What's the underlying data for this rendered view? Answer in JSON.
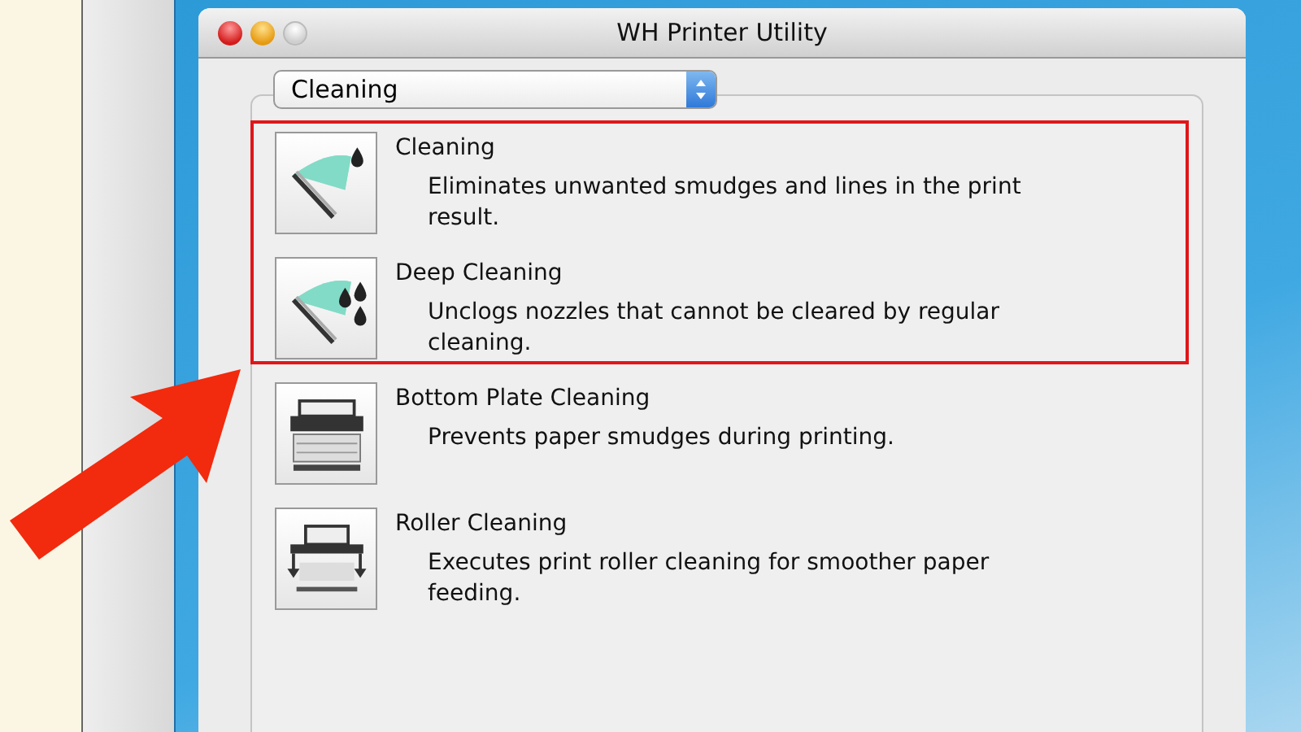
{
  "window": {
    "title": "WH Printer Utility"
  },
  "popup": {
    "value": "Cleaning"
  },
  "items": [
    {
      "kind": "wiper",
      "title": "Cleaning",
      "description": "Eliminates unwanted smudges and lines in the print result.",
      "highlighted": true
    },
    {
      "kind": "deep-wiper",
      "title": "Deep Cleaning",
      "description": "Unclogs nozzles that cannot be cleared by regular cleaning.",
      "highlighted": true
    },
    {
      "kind": "plate",
      "title": "Bottom Plate Cleaning",
      "description": "Prevents paper smudges during printing.",
      "highlighted": false
    },
    {
      "kind": "roller",
      "title": "Roller Cleaning",
      "description": "Executes print roller cleaning for smoother paper feeding.",
      "highlighted": false
    }
  ]
}
